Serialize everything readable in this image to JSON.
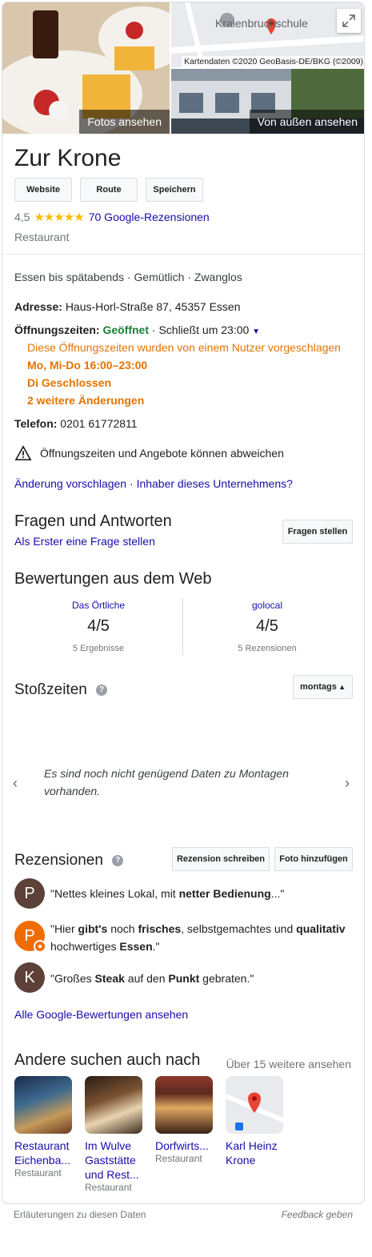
{
  "hero": {
    "photos_label": "Fotos ansehen",
    "outside_label": "Von außen ansehen",
    "map_credit": "Kartendaten ©2020 GeoBasis-DE/BKG (©2009)",
    "map_label": "Kraienbruchschule"
  },
  "business": {
    "name": "Zur Krone",
    "buttons": {
      "website": "Website",
      "route": "Route",
      "save": "Speichern"
    },
    "rating": "4,5",
    "stars": "★★★★★",
    "reviews_link": "70 Google-Rezensionen",
    "category": "Restaurant"
  },
  "details": {
    "attributes": "Essen bis spätabends · Gemütlich · Zwanglos",
    "address_label": "Adresse:",
    "address_value": "Haus-Horl-Straße 87, 45357 Essen",
    "hours_label": "Öffnungszeiten:",
    "hours_status": "Geöffnet",
    "hours_closes": " · Schließt um 23:00",
    "hours_suggested": "Diese Öffnungszeiten wurden von einem Nutzer vorgeschlagen",
    "hours_mo_do": "Mo, Mi-Do 16:00–23:00",
    "hours_di": "Di Geschlossen",
    "hours_more": "2 weitere Änderungen",
    "phone_label": "Telefon:",
    "phone_value": "0201 61772811",
    "warning": "Öffnungszeiten und Angebote können abweichen",
    "suggest_link": "Änderung vorschlagen",
    "owner_link": "Inhaber dieses Unternehmens?"
  },
  "qa": {
    "title": "Fragen und Antworten",
    "first_link": "Als Erster eine Frage stellen",
    "ask_button": "Fragen stellen"
  },
  "web_reviews": {
    "title": "Bewertungen aus dem Web",
    "items": [
      {
        "source": "Das Örtliche",
        "score": "4/5",
        "count": "5 Ergebnisse"
      },
      {
        "source": "golocal",
        "score": "4/5",
        "count": "5 Rezensionen"
      }
    ]
  },
  "popular_times": {
    "title": "Stoßzeiten",
    "day_select": "montags",
    "message": "Es sind noch nicht genügend Daten zu Montagen vorhanden."
  },
  "reviews": {
    "title": "Rezensionen",
    "write_button": "Rezension schreiben",
    "photo_button": "Foto hinzufügen",
    "items": [
      {
        "initial": "P",
        "color": "#5d4037",
        "parts": [
          "\"Nettes kleines Lokal, mit ",
          "netter Bedienung",
          "...\""
        ]
      },
      {
        "initial": "P",
        "color": "#ef6c00",
        "parts": [
          "\"Hier ",
          "gibt's",
          " noch ",
          "frisches",
          ", selbstgemachtes und ",
          "qualitativ",
          " hochwertiges ",
          "Essen",
          ".\""
        ]
      },
      {
        "initial": "K",
        "color": "#5d4037",
        "parts": [
          "\"Großes ",
          "Steak",
          " auf den ",
          "Punkt",
          " gebraten.\""
        ]
      }
    ],
    "all_link": "Alle Google-Bewertungen ansehen"
  },
  "related": {
    "title": "Andere suchen auch nach",
    "more_link": "Über 15 weitere ansehen",
    "items": [
      {
        "name1": "Restaurant",
        "name2": "Eichenba...",
        "name3": "",
        "type": "Restaurant"
      },
      {
        "name1": "Im Wulve",
        "name2": "Gaststätte",
        "name3": "und Rest...",
        "type": "Restaurant"
      },
      {
        "name1": "Dorfwirts...",
        "name2": "",
        "name3": "",
        "type": "Restaurant"
      },
      {
        "name1": "Karl Heinz",
        "name2": "Krone",
        "name3": "",
        "type": ""
      }
    ]
  },
  "footer": {
    "explanations": "Erläuterungen zu diesen Daten",
    "feedback": "Feedback geben"
  },
  "colors": {
    "link": "#1a0dab",
    "orange": "#e37400",
    "green": "#188038",
    "star": "#fbbc04"
  }
}
